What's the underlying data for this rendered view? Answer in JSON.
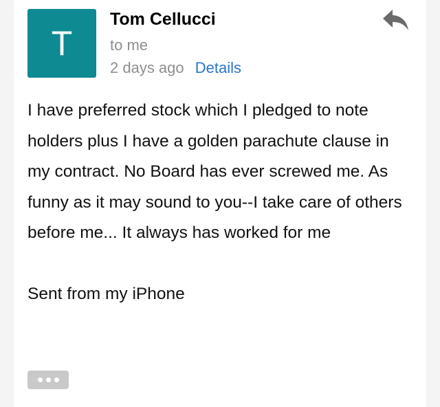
{
  "email": {
    "avatar_letter": "T",
    "avatar_color": "#0e8a92",
    "sender": "Tom Cellucci",
    "recipient": "to me",
    "time": "2 days ago",
    "details_label": "Details",
    "reply_icon": "reply-icon",
    "body_text": "I have preferred stock which I pledged to note holders plus I have a golden parachute clause in my contract. No Board has ever screwed me. As funny as it may sound to you--I take care of others before me... It always has worked for me",
    "signature": "Sent from my iPhone",
    "more_icon": "ellipsis-icon"
  },
  "colors": {
    "link": "#2a73c9",
    "muted": "#8e8e8e",
    "background": "#f4f4f4"
  }
}
